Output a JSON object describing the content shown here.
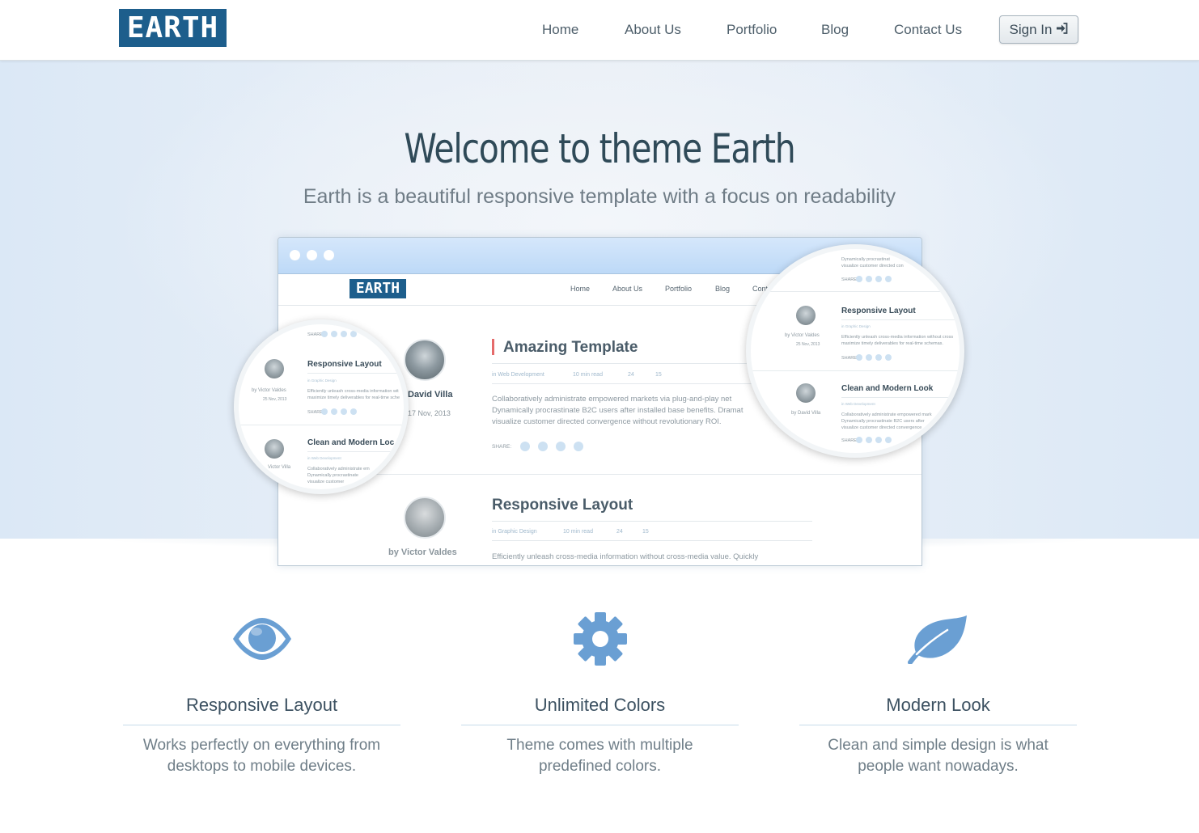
{
  "brand": {
    "logo_text": "EARTH"
  },
  "nav": {
    "items": [
      "Home",
      "About Us",
      "Portfolio",
      "Blog",
      "Contact Us"
    ],
    "signin_label": "Sign In",
    "signin_icon": "sign-in-icon"
  },
  "hero": {
    "title": "Welcome to theme Earth",
    "subtitle": "Earth is a beautiful responsive template with a focus on readability"
  },
  "preview": {
    "logo_text": "EARTH",
    "nav_items": [
      "Home",
      "About Us",
      "Portfolio",
      "Blog",
      "Cont"
    ],
    "posts": [
      {
        "author": "David Villa",
        "date": "17 Nov, 2013",
        "title": "Amazing Template",
        "meta": [
          "in Web Development",
          "10 min read",
          "24",
          "15"
        ],
        "excerpt": [
          "Collaboratively administrate empowered markets via plug-and-play net",
          "Dynamically procrastinate B2C users after installed base benefits. Dramat",
          "visualize customer directed convergence without revolutionary ROI."
        ],
        "share_label": "SHARE:"
      },
      {
        "author": "by Victor Valdes",
        "title": "Responsive Layout",
        "meta": [
          "in Graphic Design",
          "10 min read",
          "24",
          "15"
        ],
        "excerpt": [
          "Efficiently unleash cross-media information without cross-media value. Quickly"
        ]
      }
    ],
    "mag_left": {
      "items": [
        {
          "title": "Responsive Layout",
          "by": "by Victor Valdes",
          "date": "25 Nov, 2013",
          "meta": "in Graphic Design",
          "text": [
            "Efficiently unleash cross-media information wit",
            "maximize timely deliverables for real-time sche"
          ],
          "share": "SHARE"
        },
        {
          "title": "Clean and Modern Loc",
          "by": "Victor Villa",
          "meta": "in Web Development",
          "text": [
            "Collaboratively administrate em",
            "Dynamically procrastinate",
            "visualize customer"
          ]
        }
      ],
      "top_share": "SHARE"
    },
    "mag_right": {
      "top_text": [
        "Dynamically procrastinat",
        "visualize customer directed con"
      ],
      "top_share": "SHARE",
      "items": [
        {
          "title": "Responsive Layout",
          "by": "by Victor Valdes",
          "date": "25 Nov, 2013",
          "meta": "in Graphic Design",
          "text": [
            "Efficiently unleash cross-media information without cross",
            "maximize timely deliverables for real-time schemas."
          ],
          "share": "SHARE"
        },
        {
          "title": "Clean and Modern Look",
          "by": "by David Villa",
          "meta": "in Web Development",
          "text": [
            "Collaboratively administrate empowered mark",
            "Dynamically procrastinate B2C users after",
            "visualize customer directed convergence"
          ],
          "share": "SHARE"
        }
      ]
    }
  },
  "features": [
    {
      "icon": "eye-icon",
      "title": "Responsive Layout",
      "text": [
        "Works perfectly on everything from",
        "desktops to mobile devices."
      ]
    },
    {
      "icon": "gear-icon",
      "title": "Unlimited Colors",
      "text": [
        "Theme comes with multiple",
        "predefined colors."
      ]
    },
    {
      "icon": "leaf-icon",
      "title": "Modern Look",
      "text": [
        "Clean and simple design is what",
        "people want nowadays."
      ]
    }
  ],
  "colors": {
    "brand": "#1d5e8c",
    "icon": "#6a9fd3",
    "accent_red": "#e56b6b",
    "title": "#2f4a58"
  }
}
